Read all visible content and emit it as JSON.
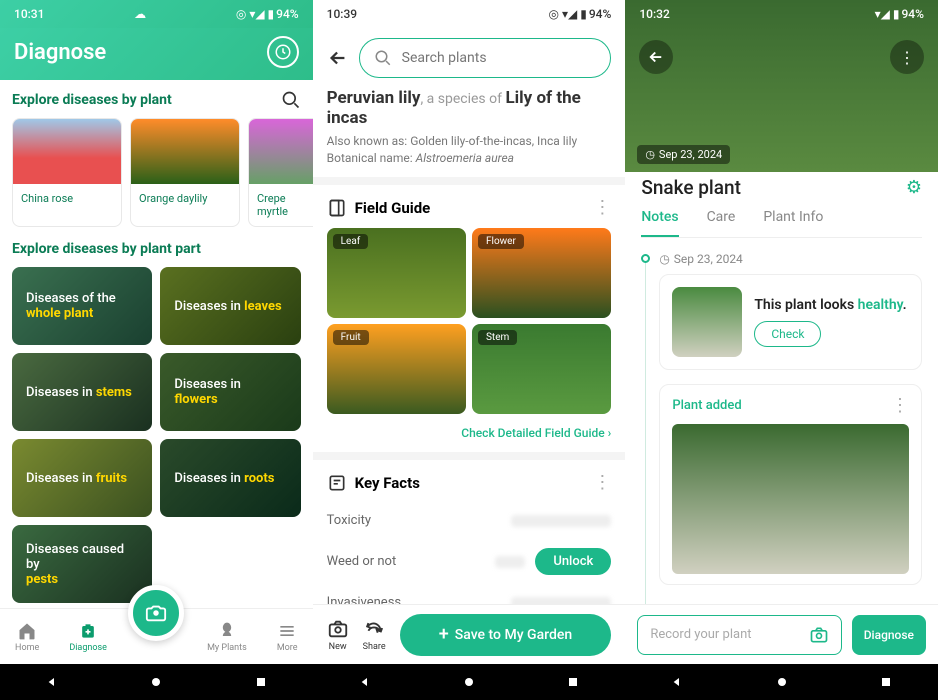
{
  "phone1": {
    "status": {
      "time": "10:31",
      "battery": "94%"
    },
    "title": "Diagnose",
    "explore_by_plant": "Explore diseases by plant",
    "plants": [
      {
        "name": "China rose"
      },
      {
        "name": "Orange daylily"
      },
      {
        "name": "Crepe myrtle"
      }
    ],
    "explore_by_part": "Explore diseases by plant part",
    "parts": [
      {
        "pre": "Diseases of the",
        "hl": "whole plant"
      },
      {
        "pre": "Diseases in",
        "hl": "leaves"
      },
      {
        "pre": "Diseases in",
        "hl": "stems"
      },
      {
        "pre": "Diseases in",
        "hl": "flowers"
      },
      {
        "pre": "Diseases in",
        "hl": "fruits"
      },
      {
        "pre": "Diseases in",
        "hl": "roots"
      },
      {
        "pre": "Diseases caused by",
        "hl": "pests"
      }
    ],
    "nav": {
      "home": "Home",
      "diagnose": "Diagnose",
      "myplants": "My Plants",
      "more": "More"
    }
  },
  "phone2": {
    "status": {
      "time": "10:39",
      "battery": "94%"
    },
    "search_placeholder": "Search plants",
    "species_main": "Peruvian lily",
    "species_mid": ", a species of ",
    "species_family": "Lily of the incas",
    "aka_label": "Also known as: ",
    "aka": "Golden lily-of-the-incas, Inca lily",
    "botanical_label": "Botanical name: ",
    "botanical": "Alstroemeria aurea",
    "field_guide": "Field Guide",
    "guide": [
      "Leaf",
      "Flower",
      "Fruit",
      "Stem"
    ],
    "check_guide": "Check Detailed Field Guide",
    "key_facts": "Key Facts",
    "facts": [
      "Toxicity",
      "Weed or not",
      "Invasiveness"
    ],
    "unlock": "Unlock",
    "bottom": {
      "new": "New",
      "share": "Share",
      "save": "Save to My Garden"
    }
  },
  "phone3": {
    "status": {
      "time": "10:32",
      "battery": "94%"
    },
    "hero_date": "Sep 23, 2024",
    "plant_name": "Snake plant",
    "tabs": {
      "notes": "Notes",
      "care": "Care",
      "info": "Plant Info"
    },
    "tl_date": "Sep 23, 2024",
    "health_pre": "This plant looks ",
    "health_word": "healthy",
    "health_post": ".",
    "check": "Check",
    "added": "Plant added",
    "record_placeholder": "Record your plant",
    "diagnose": "Diagnose"
  }
}
